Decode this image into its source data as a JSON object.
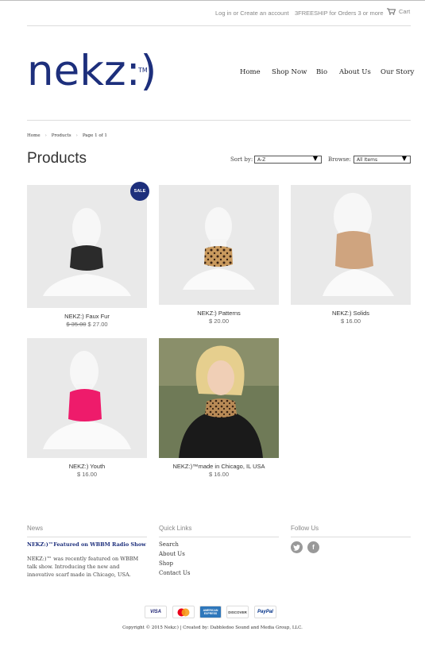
{
  "topbar": {
    "login": "Log in",
    "or": "or",
    "create": "Create an account",
    "promo": "3FREESHIP for Orders 3 or more",
    "cart": "Cart"
  },
  "logo": {
    "text": "nekz:)",
    "tm": "TM"
  },
  "nav": [
    "Home",
    "Shop Now",
    "Bio",
    "About Us",
    "Our Story"
  ],
  "breadcrumb": [
    "Home",
    "Products",
    "Page 1 of 1"
  ],
  "page_title": "Products",
  "sort": {
    "label": "Sort by:",
    "value": "A-Z"
  },
  "browse": {
    "label": "Browse:",
    "value": "All Items"
  },
  "sale_badge": "SALE",
  "products": [
    {
      "name": "NEKZ:) Faux Fur",
      "old_price": "$ 35.00",
      "price": "$ 27.00",
      "scarf_color": "#2b2b2b",
      "pattern": "solid"
    },
    {
      "name": "NEKZ:) Patterns",
      "price": "$ 20.00",
      "scarf_color": "#8a5a2e",
      "pattern": "leopard"
    },
    {
      "name": "NEKZ:) Solids",
      "price": "$ 16.00",
      "scarf_color": "#cfa47f",
      "pattern": "solid"
    },
    {
      "name": "NEKZ:) Youth",
      "price": "$ 16.00",
      "scarf_color": "#ee1b6b",
      "pattern": "solid"
    },
    {
      "name": "NEKZ:)™made in Chicago, IL USA",
      "price": "$ 16.00",
      "scarf_color": "#8a5a2e",
      "pattern": "photo"
    }
  ],
  "footer": {
    "news_heading": "News",
    "news_title": "NEKZ:)™Featured on WBBM Radio Show",
    "news_body": "NEKZ:)™ was recently featured on WBBM talk show. Introducing the new and innovative scarf made in Chicago, USA.",
    "links_heading": "Quick Links",
    "links": [
      "Search",
      "About Us",
      "Shop",
      "Contact Us"
    ],
    "follow_heading": "Follow Us",
    "social": [
      "twitter-icon",
      "facebook-icon"
    ]
  },
  "payments": [
    {
      "label": "VISA",
      "color": "#1a1f71"
    },
    {
      "label": "MasterCard",
      "color": "#eb001b"
    },
    {
      "label": "AMERICAN EXPRESS",
      "color": "#2e77bb"
    },
    {
      "label": "DISCOVER",
      "color": "#f58220"
    },
    {
      "label": "PayPal",
      "color": "#003087"
    }
  ],
  "copyright": "Copyright © 2015 Nekz:) | Created by: Dabbledoo Sound and Media Group, LLC.",
  "colors": {
    "brand": "#1d2f7c"
  }
}
